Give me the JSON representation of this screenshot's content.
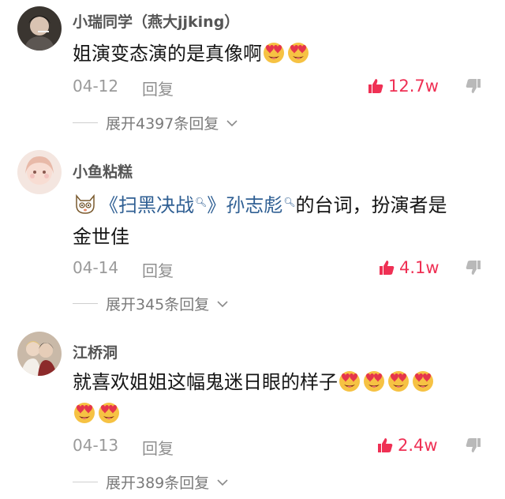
{
  "comments": [
    {
      "username": "小瑞同学（燕大jjking）",
      "text": "姐演变态演的是真像啊",
      "emoji_count": 2,
      "date": "04-12",
      "reply_label": "回复",
      "likes": "12.7w",
      "expand_label": "展开4397条回复"
    },
    {
      "username": "小鱼粘糕",
      "link1": "《扫黑决战",
      "link1_end": "》",
      "link2": "孙志彪",
      "text_after": "的台词，扮演者是",
      "text_line2": "金世佳",
      "date": "04-14",
      "reply_label": "回复",
      "likes": "4.1w",
      "expand_label": "展开345条回复"
    },
    {
      "username": "江桥洞",
      "text": "就喜欢姐姐这幅鬼迷日眼的样子",
      "emoji_count": 6,
      "date": "04-13",
      "reply_label": "回复",
      "likes": "2.4w",
      "expand_label": "展开389条回复"
    }
  ],
  "colors": {
    "like_red": "#ef3054",
    "link_blue": "#2f5f93",
    "muted_gray": "#9a9a9a"
  },
  "icons": {
    "like": "thumbs-up-icon",
    "dislike": "thumbs-down-icon",
    "emoji": "heart-eyes-emoji-icon",
    "search": "search-icon",
    "chevron": "chevron-down-icon"
  }
}
